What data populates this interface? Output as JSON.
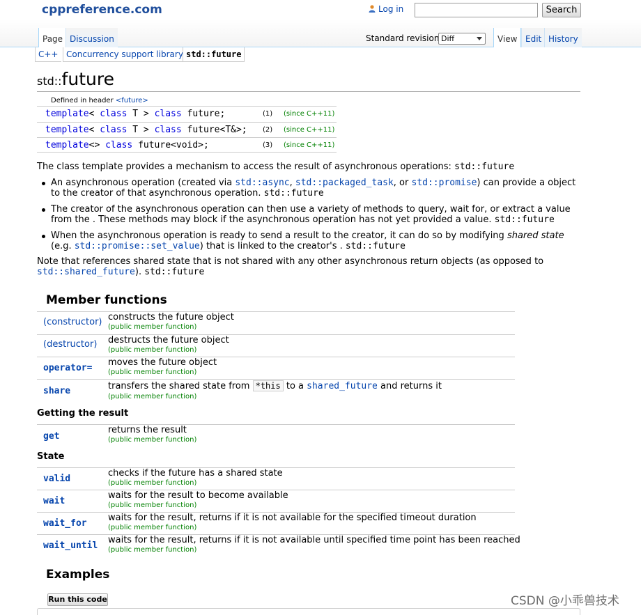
{
  "header": {
    "site": "cppreference.com",
    "login": "Log in",
    "search_placeholder": "",
    "search_button": "Search",
    "tabs": [
      "Page",
      "Discussion"
    ],
    "revision_label": "Standard revision:",
    "revision_value": "Diff",
    "actions": [
      "View",
      "Edit",
      "History"
    ]
  },
  "breadcrumb": [
    "C++",
    "Concurrency support library",
    "std::future"
  ],
  "title": {
    "ns": "std::",
    "name": "future"
  },
  "declarations": {
    "header_label": "Defined in header",
    "header_name": "<future>",
    "rows": [
      {
        "kw1": "template",
        "p1": "< ",
        "kw2": "class",
        "mid": " T > ",
        "kw3": "class",
        "tail": " future",
        "sym": ";",
        "num": "(1)",
        "since": "(since C++11)"
      },
      {
        "kw1": "template",
        "p1": "< ",
        "kw2": "class",
        "mid": " T > ",
        "kw3": "class",
        "tail": " future",
        "sym": "<T&>;",
        "num": "(2)",
        "since": "(since C++11)"
      },
      {
        "kw1": "template",
        "p1": "<> ",
        "kw2": "class",
        "mid": "",
        "kw3": "",
        "tail": " future",
        "sym": "<void>;",
        "num": "(3)",
        "since": "(since C++11)"
      }
    ]
  },
  "intro": {
    "text": "The class template provides a mechanism to access the result of asynchronous operations: ",
    "code": "std::future"
  },
  "bullets": {
    "b1": {
      "t1": "An asynchronous operation (created via ",
      "l1": "std::async",
      "t2": ", ",
      "l2": "std::packaged_task",
      "t3": ", or ",
      "l3": "std::promise",
      "t4": ") can provide a object to the creator of that asynchronous operation. ",
      "code": "std::future"
    },
    "b2": {
      "t1": "The creator of the asynchronous operation can then use a variety of methods to query, wait for, or extract a value from the . These methods may block if the asynchronous operation has not yet provided a value. ",
      "code": "std::future"
    },
    "b3": {
      "t1": "When the asynchronous operation is ready to send a result to the creator, it can do so by modifying ",
      "em": "shared state",
      "t2": " (e.g. ",
      "l1": "std::promise::set_value",
      "t3": ") that is linked to the creator's . ",
      "code": "std::future"
    }
  },
  "note": {
    "t1": "Note that references shared state that is not shared with any other asynchronous return objects (as opposed to ",
    "l1": "std::shared_future",
    "t2": "). ",
    "code": "std::future"
  },
  "member_functions": {
    "heading": "Member functions",
    "sub_label": "(public member function)",
    "groups": {
      "getting_result": "Getting the result",
      "state": "State"
    },
    "items": [
      {
        "name": "(constructor)",
        "desc": "constructs the future object"
      },
      {
        "name": "(destructor)",
        "desc": "destructs the future object"
      },
      {
        "name": "operator=",
        "desc": "moves the future object"
      },
      {
        "name": "share",
        "desc_a": "transfers the shared state from ",
        "kbd": "*this",
        "desc_b": " to a ",
        "link": "shared_future",
        "desc_c": " and returns it"
      },
      {
        "name": "get",
        "desc": "returns the result"
      },
      {
        "name": "valid",
        "desc": "checks if the future has a shared state"
      },
      {
        "name": "wait",
        "desc": "waits for the result to become available"
      },
      {
        "name": "wait_for",
        "desc": "waits for the result, returns if it is not available for the specified timeout duration"
      },
      {
        "name": "wait_until",
        "desc": "waits for the result, returns if it is not available until specified time point has been reached"
      }
    ]
  },
  "examples": {
    "heading": "Examples",
    "run_button": "Run this code"
  },
  "watermark": "CSDN @小乖兽技术",
  "colors": {
    "link": "#0645ad",
    "green": "#008000",
    "keyword": "#0000dd",
    "tab_border": "#a7d7f9"
  },
  "icons": [
    "user-icon",
    "dropdown-caret-icon"
  ]
}
